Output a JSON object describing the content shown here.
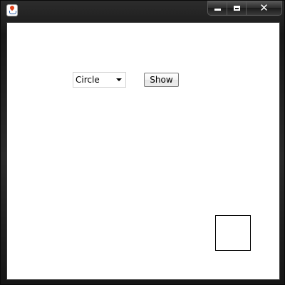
{
  "window": {
    "icon": "java-coffee-cup-icon",
    "minimize_icon": "minimize-icon",
    "maximize_icon": "maximize-icon",
    "close_icon": "close-icon",
    "close_glyph": "✕"
  },
  "controls": {
    "shape_select": {
      "selected": "Circle"
    },
    "show_label": "Show"
  },
  "canvas": {
    "shape_drawn": "square",
    "stroke_color": "#000000"
  }
}
